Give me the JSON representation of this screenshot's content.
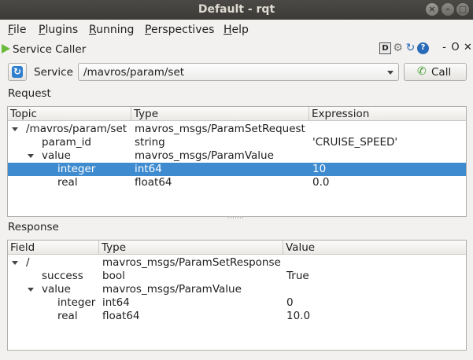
{
  "window": {
    "title": "Default - rqt"
  },
  "menubar": {
    "items": [
      {
        "accel": "F",
        "rest": "ile"
      },
      {
        "accel": "P",
        "rest": "lugins"
      },
      {
        "accel": "R",
        "rest": "unning"
      },
      {
        "accel": "P",
        "rest": "erspectives"
      },
      {
        "accel": "H",
        "rest": "elp"
      }
    ]
  },
  "plugin": {
    "title": "Service Caller",
    "help_label": "D",
    "dash": "-",
    "o": "O",
    "x": "✕"
  },
  "service": {
    "label": "Service",
    "selected": "/mavros/param/set",
    "call_label": "Call"
  },
  "request": {
    "label": "Request",
    "headers": [
      "Topic",
      "Type",
      "Expression"
    ],
    "rows": [
      {
        "name": "/mavros/param/set",
        "type": "mavros_msgs/ParamSetRequest",
        "expr": ""
      },
      {
        "name": "param_id",
        "type": "string",
        "expr": "'CRUISE_SPEED'"
      },
      {
        "name": "value",
        "type": "mavros_msgs/ParamValue",
        "expr": ""
      },
      {
        "name": "integer",
        "type": "int64",
        "expr": "10"
      },
      {
        "name": "real",
        "type": "float64",
        "expr": "0.0"
      }
    ]
  },
  "response": {
    "label": "Response",
    "headers": [
      "Field",
      "Type",
      "Value"
    ],
    "rows": [
      {
        "name": "/",
        "type": "mavros_msgs/ParamSetResponse",
        "value": ""
      },
      {
        "name": "success",
        "type": "bool",
        "value": "True"
      },
      {
        "name": "value",
        "type": "mavros_msgs/ParamValue",
        "value": ""
      },
      {
        "name": "integer",
        "type": "int64",
        "value": "0"
      },
      {
        "name": "real",
        "type": "float64",
        "value": "10.0"
      }
    ]
  },
  "colors": {
    "selection": "#3e8bd0",
    "titlebar": "#3c3b37"
  }
}
